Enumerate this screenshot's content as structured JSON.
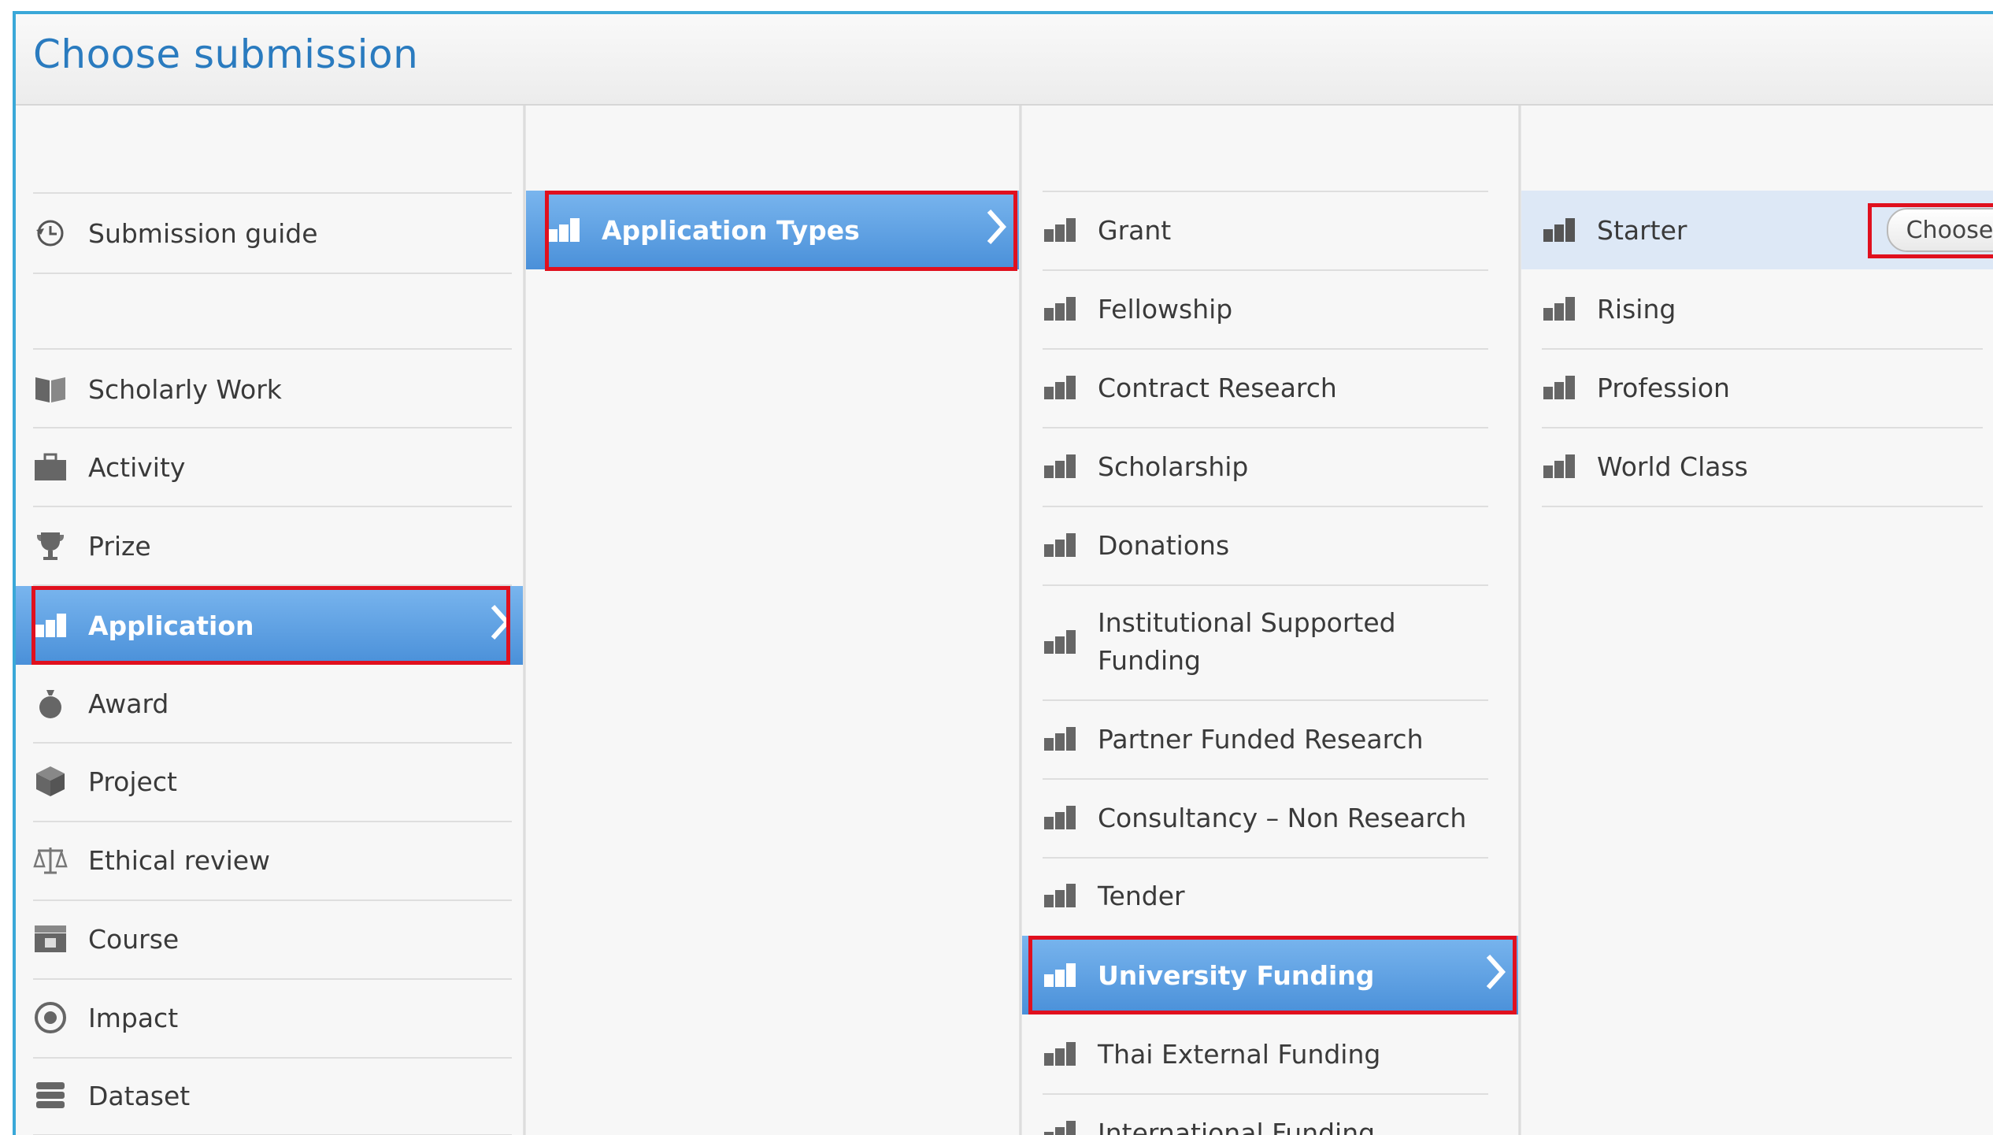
{
  "dialog": {
    "title": "Choose submission"
  },
  "colors": {
    "accent": "#2a7bbf",
    "selected": "#4a90d9",
    "highlight": "#e0101e",
    "frame": "#3aa8d8"
  },
  "column1": {
    "items": [
      {
        "label": "Submission guide",
        "icon": "history-icon"
      },
      {
        "label": "Scholarly Work",
        "icon": "book-icon"
      },
      {
        "label": "Activity",
        "icon": "briefcase-icon"
      },
      {
        "label": "Prize",
        "icon": "trophy-icon"
      },
      {
        "label": "Application",
        "icon": "chart-bars-icon",
        "selected": true
      },
      {
        "label": "Award",
        "icon": "money-bag-icon"
      },
      {
        "label": "Project",
        "icon": "cube-icon"
      },
      {
        "label": "Ethical review",
        "icon": "scales-icon"
      },
      {
        "label": "Course",
        "icon": "clapperboard-icon"
      },
      {
        "label": "Impact",
        "icon": "target-icon"
      },
      {
        "label": "Dataset",
        "icon": "database-icon"
      }
    ]
  },
  "column2": {
    "items": [
      {
        "label": "Application Types",
        "icon": "chart-bars-icon",
        "selected": true
      }
    ]
  },
  "column3": {
    "items": [
      {
        "label": "Grant"
      },
      {
        "label": "Fellowship"
      },
      {
        "label": "Contract Research"
      },
      {
        "label": "Scholarship"
      },
      {
        "label": "Donations"
      },
      {
        "label": "Institutional Supported Funding"
      },
      {
        "label": "Partner Funded Research"
      },
      {
        "label": "Consultancy – Non Research"
      },
      {
        "label": "Tender"
      },
      {
        "label": "University Funding",
        "selected": true
      },
      {
        "label": "Thai External Funding"
      },
      {
        "label": "International Funding"
      }
    ]
  },
  "column4": {
    "items": [
      {
        "label": "Starter",
        "selected": true
      },
      {
        "label": "Rising"
      },
      {
        "label": "Profession"
      },
      {
        "label": "World Class"
      }
    ],
    "choose_label": "Choose"
  }
}
